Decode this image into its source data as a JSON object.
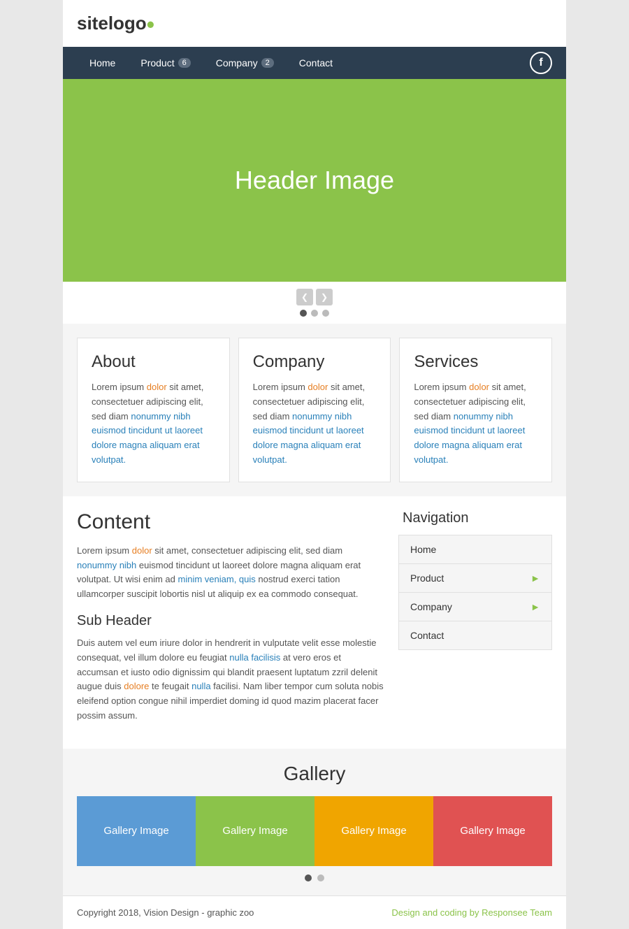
{
  "site": {
    "logo_site": "site",
    "logo_logo": "logo",
    "logo_dot": "●"
  },
  "navbar": {
    "items": [
      {
        "label": "Home",
        "badge": null
      },
      {
        "label": "Product",
        "badge": "6"
      },
      {
        "label": "Company",
        "badge": "2"
      },
      {
        "label": "Contact",
        "badge": null
      }
    ],
    "facebook_label": "f"
  },
  "hero": {
    "text": "Header Image",
    "dots": [
      true,
      false,
      false
    ]
  },
  "cards": [
    {
      "title": "About",
      "text": "Lorem ipsum dolor sit amet, consectetuer adipiscing elit, sed diam nonummy nibh euismod tincidunt ut laoreet dolore magna aliquam erat volutpat."
    },
    {
      "title": "Company",
      "text": "Lorem ipsum dolor sit amet, consectetuer adipiscing elit, sed diam nonummy nibh euismod tincidunt ut laoreet dolore magna aliquam erat volutpat."
    },
    {
      "title": "Services",
      "text": "Lorem ipsum dolor sit amet, consectetuer adipiscing elit, sed diam nonummy nibh euismod tincidunt ut laoreet dolore magna aliquam erat volutpat."
    }
  ],
  "content": {
    "title": "Content",
    "text1": "Lorem ipsum dolor sit amet, consectetuer adipiscing elit, sed diam nonummy nibh euismod tincidunt ut laoreet dolore magna aliquam erat volutpat. Ut wisi enim ad minim veniam, quis nostrud exerci tation ullamcorper suscipit lobortis nisl ut aliquip ex ea commodo consequat.",
    "subheader": "Sub Header",
    "text2": "Duis autem vel eum iriure dolor in hendrerit in vulputate velit esse molestie consequat, vel illum dolore eu feugiat nulla facilisis at vero eros et accumsan et iusto odio dignissim qui blandit praesent luptatum zzril delenit augue duis dolore te feugait nulla facilisi. Nam liber tempor cum soluta nobis eleifend option congue nihil imperdiet doming id quod mazim placerat facer possim assum."
  },
  "navigation": {
    "title": "Navigation",
    "items": [
      {
        "label": "Home",
        "has_arrow": false
      },
      {
        "label": "Product",
        "has_arrow": true
      },
      {
        "label": "Company",
        "has_arrow": true
      },
      {
        "label": "Contact",
        "has_arrow": false
      }
    ]
  },
  "gallery": {
    "title": "Gallery",
    "images": [
      {
        "label": "Gallery Image",
        "color": "#5b9bd5"
      },
      {
        "label": "Gallery Image",
        "color": "#8bc34a"
      },
      {
        "label": "Gallery Image",
        "color": "#f0a500"
      },
      {
        "label": "Gallery Image",
        "color": "#e05252"
      }
    ]
  },
  "footer": {
    "copyright": "Copyright 2018, Vision Design - graphic zoo",
    "credit": "Design and coding by Responsee Team"
  }
}
